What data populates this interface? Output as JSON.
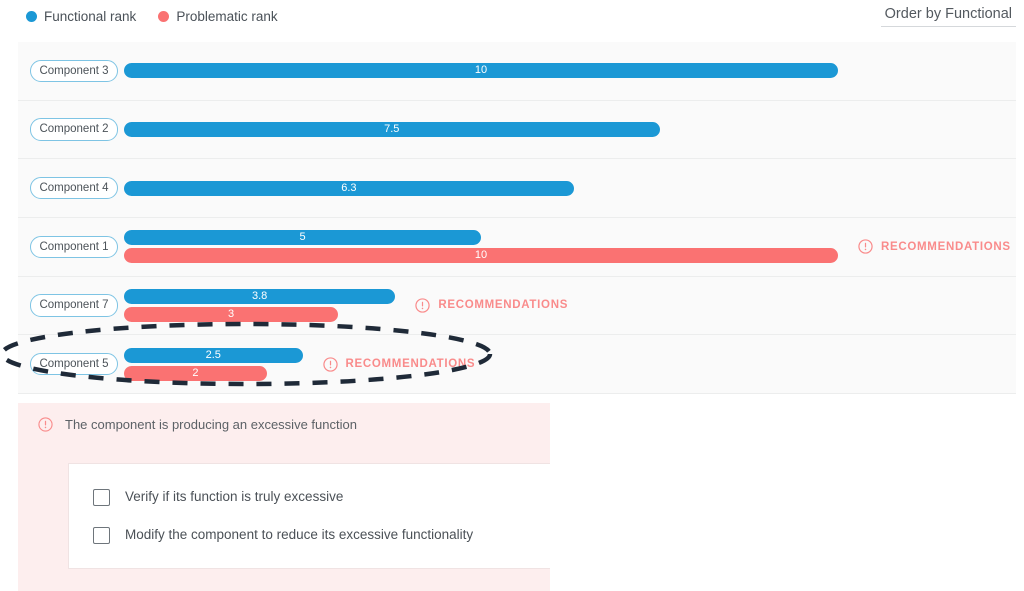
{
  "legend": {
    "items": [
      {
        "label": "Functional rank",
        "color": "#1b98d5",
        "icon": "dot-icon"
      },
      {
        "label": "Problematic rank",
        "color": "#fa7272",
        "icon": "dot-icon"
      }
    ]
  },
  "order_by": {
    "label": "Order by Functional"
  },
  "recommendation_flag_label": "RECOMMENDATIONS",
  "recommendation_panel": {
    "icon": "exclamation-circle-icon",
    "title": "The component is producing an excessive function",
    "options": [
      {
        "label": "Verify if its function is truly excessive",
        "checked": false
      },
      {
        "label": "Modify the component to reduce its excessive functionality",
        "checked": false
      }
    ]
  },
  "colors": {
    "functional": "#1b98d5",
    "problematic": "#fa7272",
    "flag_text": "#f98b8b",
    "panel_bg": "#fdeeee",
    "chart_bg": "#fafafa",
    "label_border": "#7ec4e4",
    "annotation": "#1f2a38"
  },
  "annotation": {
    "shape": "dashed-ellipse",
    "targets": "Component 5"
  },
  "chart_data": {
    "type": "bar",
    "orientation": "horizontal",
    "title": "",
    "xlabel": "",
    "ylabel": "",
    "xlim": [
      0,
      10
    ],
    "grid": false,
    "legend_position": "top-left",
    "categories": [
      "Component 3",
      "Component 2",
      "Component 4",
      "Component 1",
      "Component 7",
      "Component 5"
    ],
    "series": [
      {
        "name": "Functional rank",
        "color": "#1b98d5",
        "values": [
          10,
          7.5,
          6.3,
          5,
          3.8,
          2.5
        ]
      },
      {
        "name": "Problematic rank",
        "color": "#fa7272",
        "values": [
          null,
          null,
          null,
          10,
          3,
          2
        ]
      }
    ],
    "rows": [
      {
        "label": "Component 3",
        "functional": 10,
        "functional_text": "10",
        "problematic": null,
        "problematic_text": "",
        "recommendations": false
      },
      {
        "label": "Component 2",
        "functional": 7.5,
        "functional_text": "7.5",
        "problematic": null,
        "problematic_text": "",
        "recommendations": false
      },
      {
        "label": "Component 4",
        "functional": 6.3,
        "functional_text": "6.3",
        "problematic": null,
        "problematic_text": "",
        "recommendations": false
      },
      {
        "label": "Component 1",
        "functional": 5,
        "functional_text": "5",
        "problematic": 10,
        "problematic_text": "10",
        "recommendations": true
      },
      {
        "label": "Component 7",
        "functional": 3.8,
        "functional_text": "3.8",
        "problematic": 3,
        "problematic_text": "3",
        "recommendations": true
      },
      {
        "label": "Component 5",
        "functional": 2.5,
        "functional_text": "2.5",
        "problematic": 2,
        "problematic_text": "2",
        "recommendations": true
      }
    ]
  }
}
